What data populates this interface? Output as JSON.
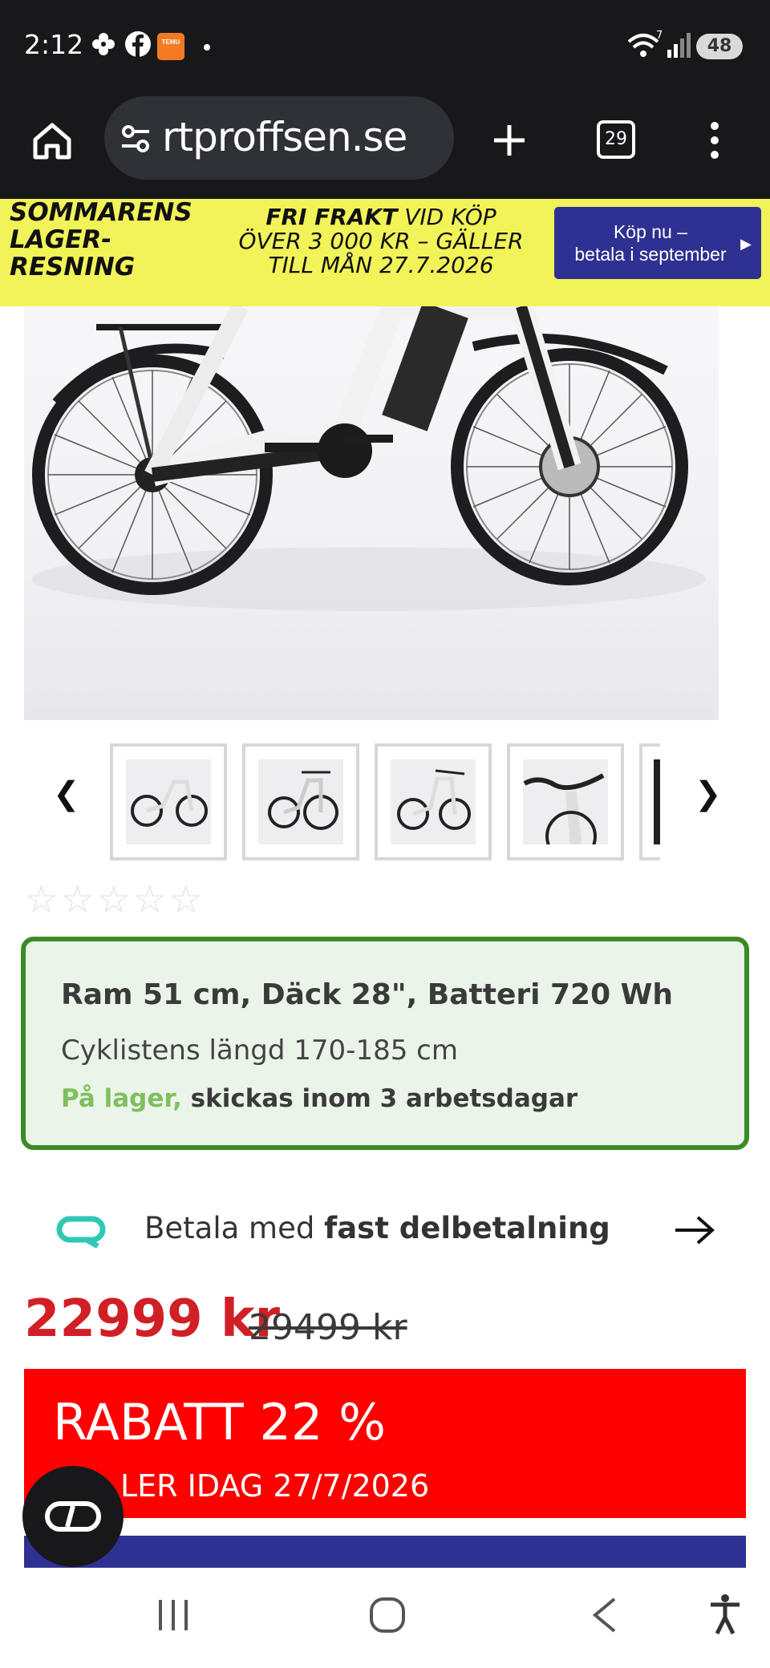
{
  "status_bar": {
    "time": "2:12",
    "temu_label": "TEMU",
    "wifi_badge": "7",
    "battery": "48"
  },
  "browser": {
    "url": "rtproffsen.se",
    "tab_count": "29"
  },
  "promo": {
    "left_lines": [
      "SOMMARENS",
      "LAGER-",
      "RESNING"
    ],
    "mid_bold": "FRI FRAKT",
    "mid_rest_1": " VID KÖP",
    "mid_line_2": "ÖVER 3 000 KR – GÄLLER",
    "mid_line_3": "TILL MÅN 27.7.2026",
    "button_line_1": "Köp nu –",
    "button_line_2": "betala i september"
  },
  "product": {
    "image_icon": "e-bike-image",
    "thumbnail_count": 5,
    "rating_stars": 0,
    "rating_max": 5
  },
  "info_box": {
    "title": "Ram 51 cm, Däck 28\", Batteri 720 Wh",
    "subtitle": "Cyklistens längd 170-185 cm",
    "stock_status": "På lager,",
    "shipping": " skickas inom 3 arbetsdagar"
  },
  "payment": {
    "prefix": "Betala med ",
    "bold": "fast delbetalning"
  },
  "pricing": {
    "price": "22999 kr",
    "old_price": "29499 kr"
  },
  "discount": {
    "title": "RABATT 22 %",
    "valid_text": "LER IDAG 27/7/2026"
  },
  "colors": {
    "promo_yellow": "#f1f358",
    "promo_button": "#2e3191",
    "price_red": "#d11f26",
    "discount_red": "#ff0000",
    "info_green": "#3a8b26"
  }
}
